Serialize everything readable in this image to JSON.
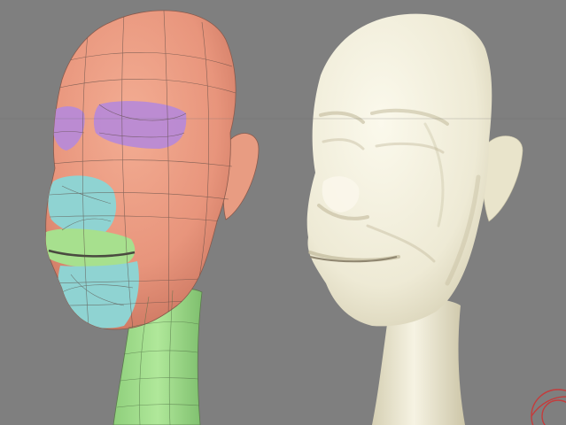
{
  "viewport": {
    "background": "#7f7f7f",
    "left_model": {
      "kind": "wireframe-head-with-color-regions",
      "regions": {
        "skin": "#e8957c",
        "brows": "#b88ad6",
        "nose_chin": "#8fd3d2",
        "mouth_neck": "#a7e08e"
      },
      "wire_color": "#5a4a44"
    },
    "right_model": {
      "kind": "smooth-shaded-head",
      "base_color": "#eeead5",
      "shadow_color": "#c9c3a6"
    },
    "gizmo": {
      "icon": "rotate-gizmo-icon",
      "color": "#c43c3c"
    }
  }
}
